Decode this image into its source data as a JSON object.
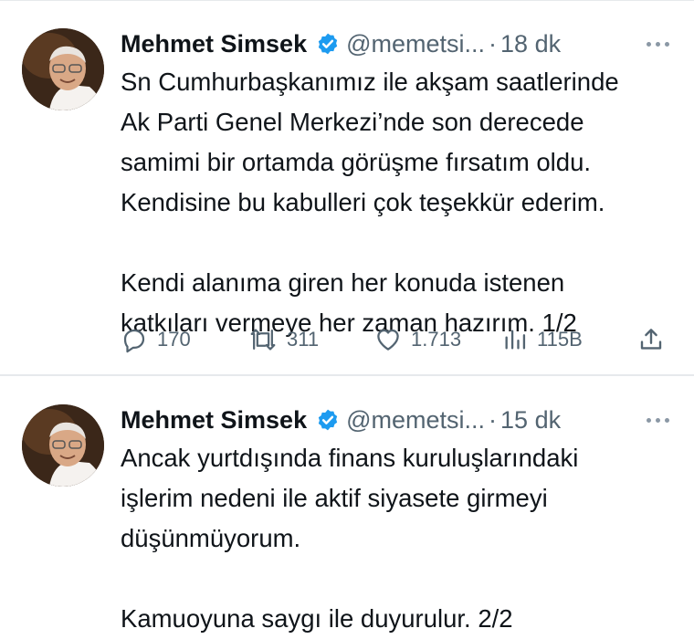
{
  "tweets": [
    {
      "author_name": "Mehmet Simsek",
      "handle": "@memetsi...",
      "separator": "·",
      "time": "18 dk",
      "paragraphs": [
        [
          "Sn Cumhurbaşkanımız ile akşam saatlerinde",
          "Ak Parti Genel Merkezi’nde son derecede",
          "samimi bir ortamda görüşme fırsatım oldu.",
          "Kendisine bu kabulleri çok teşekkür ederim."
        ],
        [
          "Kendi alanıma giren her konuda istenen",
          "katkıları vermeye her zaman hazırım.  1/2"
        ]
      ],
      "stats": {
        "replies": "170",
        "retweets": "311",
        "likes": "1.713",
        "views": "115B"
      }
    },
    {
      "author_name": "Mehmet Simsek",
      "handle": "@memetsi...",
      "separator": "·",
      "time": "15 dk",
      "paragraphs": [
        [
          "Ancak yurtdışında finans kuruluşlarındaki",
          "işlerim nedeni ile aktif siyasete girmeyi",
          "düşünmüyorum."
        ],
        [
          "Kamuoyuna saygı ile duyurulur. 2/2"
        ]
      ]
    }
  ],
  "icons": {
    "verified": "verified-badge-icon",
    "more": "more-options-icon",
    "reply": "reply-icon",
    "retweet": "retweet-icon",
    "like": "heart-icon",
    "views": "views-chart-icon",
    "share": "share-icon"
  },
  "colors": {
    "verified": "#1d9bf0",
    "muted": "#536471",
    "text": "#0f1419",
    "divider": "#e6e9ec"
  }
}
